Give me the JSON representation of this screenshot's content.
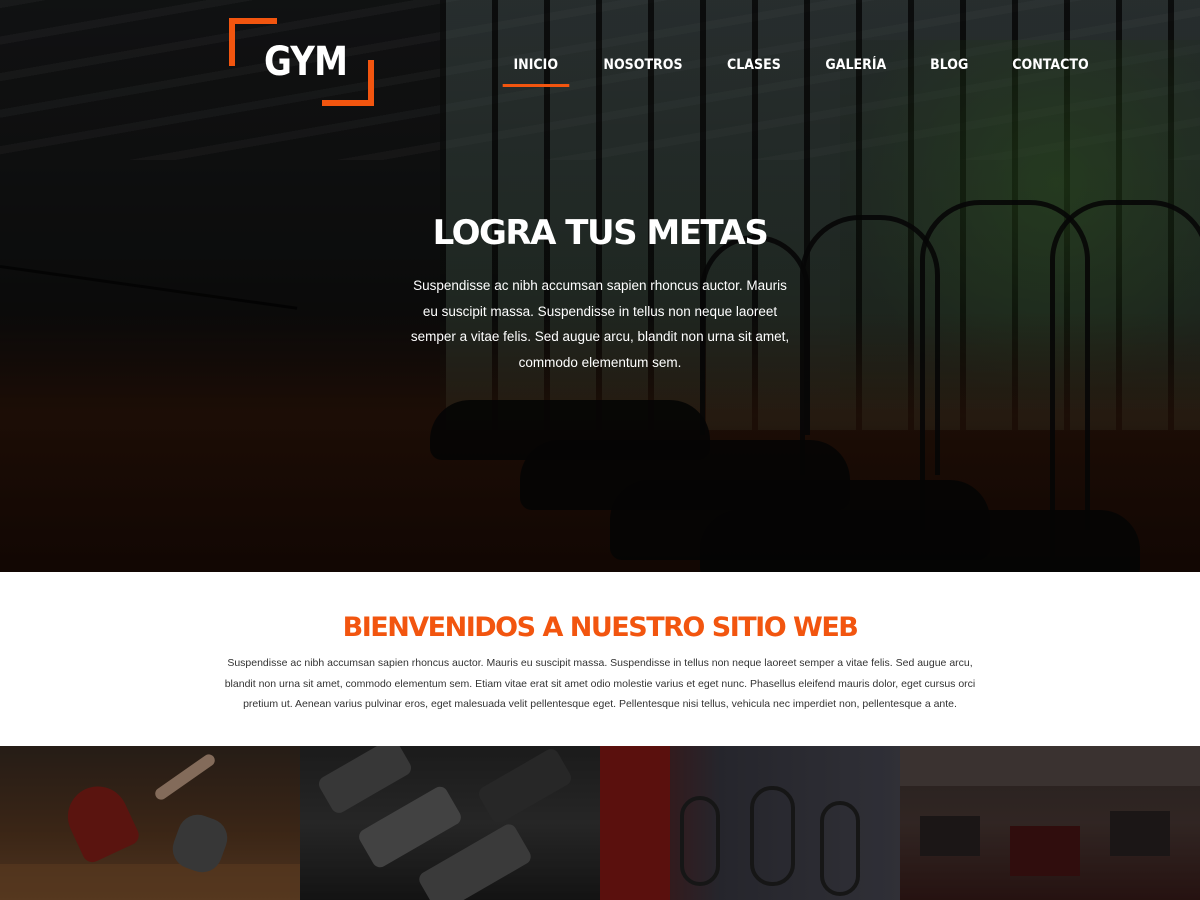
{
  "brand": {
    "logo_text": "GYM",
    "accent_color": "#f2550f"
  },
  "nav": {
    "items": [
      {
        "label": "INICIO",
        "active": true
      },
      {
        "label": "NOSOTROS",
        "active": false
      },
      {
        "label": "CLASES",
        "active": false
      },
      {
        "label": "GALERÍA",
        "active": false
      },
      {
        "label": "BLOG",
        "active": false
      },
      {
        "label": "CONTACTO",
        "active": false
      }
    ]
  },
  "hero": {
    "title": "LOGRA TUS METAS",
    "text": "Suspendisse ac nibh accumsan sapien rhoncus auctor. Mauris eu suscipit massa. Suspendisse in tellus non neque laoreet semper a vitae felis. Sed augue arcu, blandit non urna sit amet, commodo elementum sem."
  },
  "welcome": {
    "title": "BIENVENIDOS A NUESTRO SITIO WEB",
    "text": "Suspendisse ac nibh accumsan sapien rhoncus auctor. Mauris eu suscipit massa. Suspendisse in tellus non neque laoreet semper a vitae felis. Sed augue arcu, blandit non urna sit amet, commodo elementum sem. Etiam vitae erat sit amet odio molestie varius et eget nunc. Phasellus eleifend mauris dolor, eget cursus orci pretium ut. Aenean varius pulvinar eros, eget malesuada velit pellentesque eget. Pellentesque nisi tellus, vehicula nec imperdiet non, pellentesque a ante."
  }
}
